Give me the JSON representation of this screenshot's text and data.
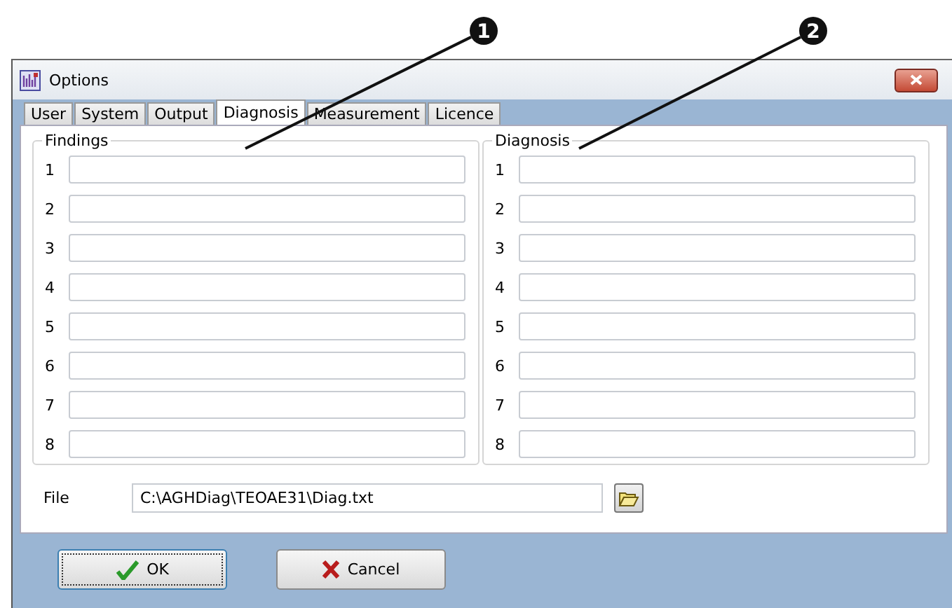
{
  "callouts": [
    {
      "number": "1"
    },
    {
      "number": "2"
    }
  ],
  "window": {
    "title": "Options"
  },
  "tabs": [
    {
      "label": "User",
      "selected": false
    },
    {
      "label": "System",
      "selected": false
    },
    {
      "label": "Output",
      "selected": false
    },
    {
      "label": "Diagnosis",
      "selected": true
    },
    {
      "label": "Measurement",
      "selected": false
    },
    {
      "label": "Licence",
      "selected": false
    }
  ],
  "groups": [
    {
      "title": "Findings",
      "rows": [
        "1",
        "2",
        "3",
        "4",
        "5",
        "6",
        "7",
        "8"
      ]
    },
    {
      "title": "Diagnosis",
      "rows": [
        "1",
        "2",
        "3",
        "4",
        "5",
        "6",
        "7",
        "8"
      ]
    }
  ],
  "file": {
    "label": "File",
    "value": "C:\\AGHDiag\\TEOAE31\\Diag.txt"
  },
  "buttons": [
    {
      "kind": "ok",
      "label": "OK",
      "focused": true
    },
    {
      "kind": "cancel",
      "label": "Cancel",
      "focused": false
    }
  ]
}
